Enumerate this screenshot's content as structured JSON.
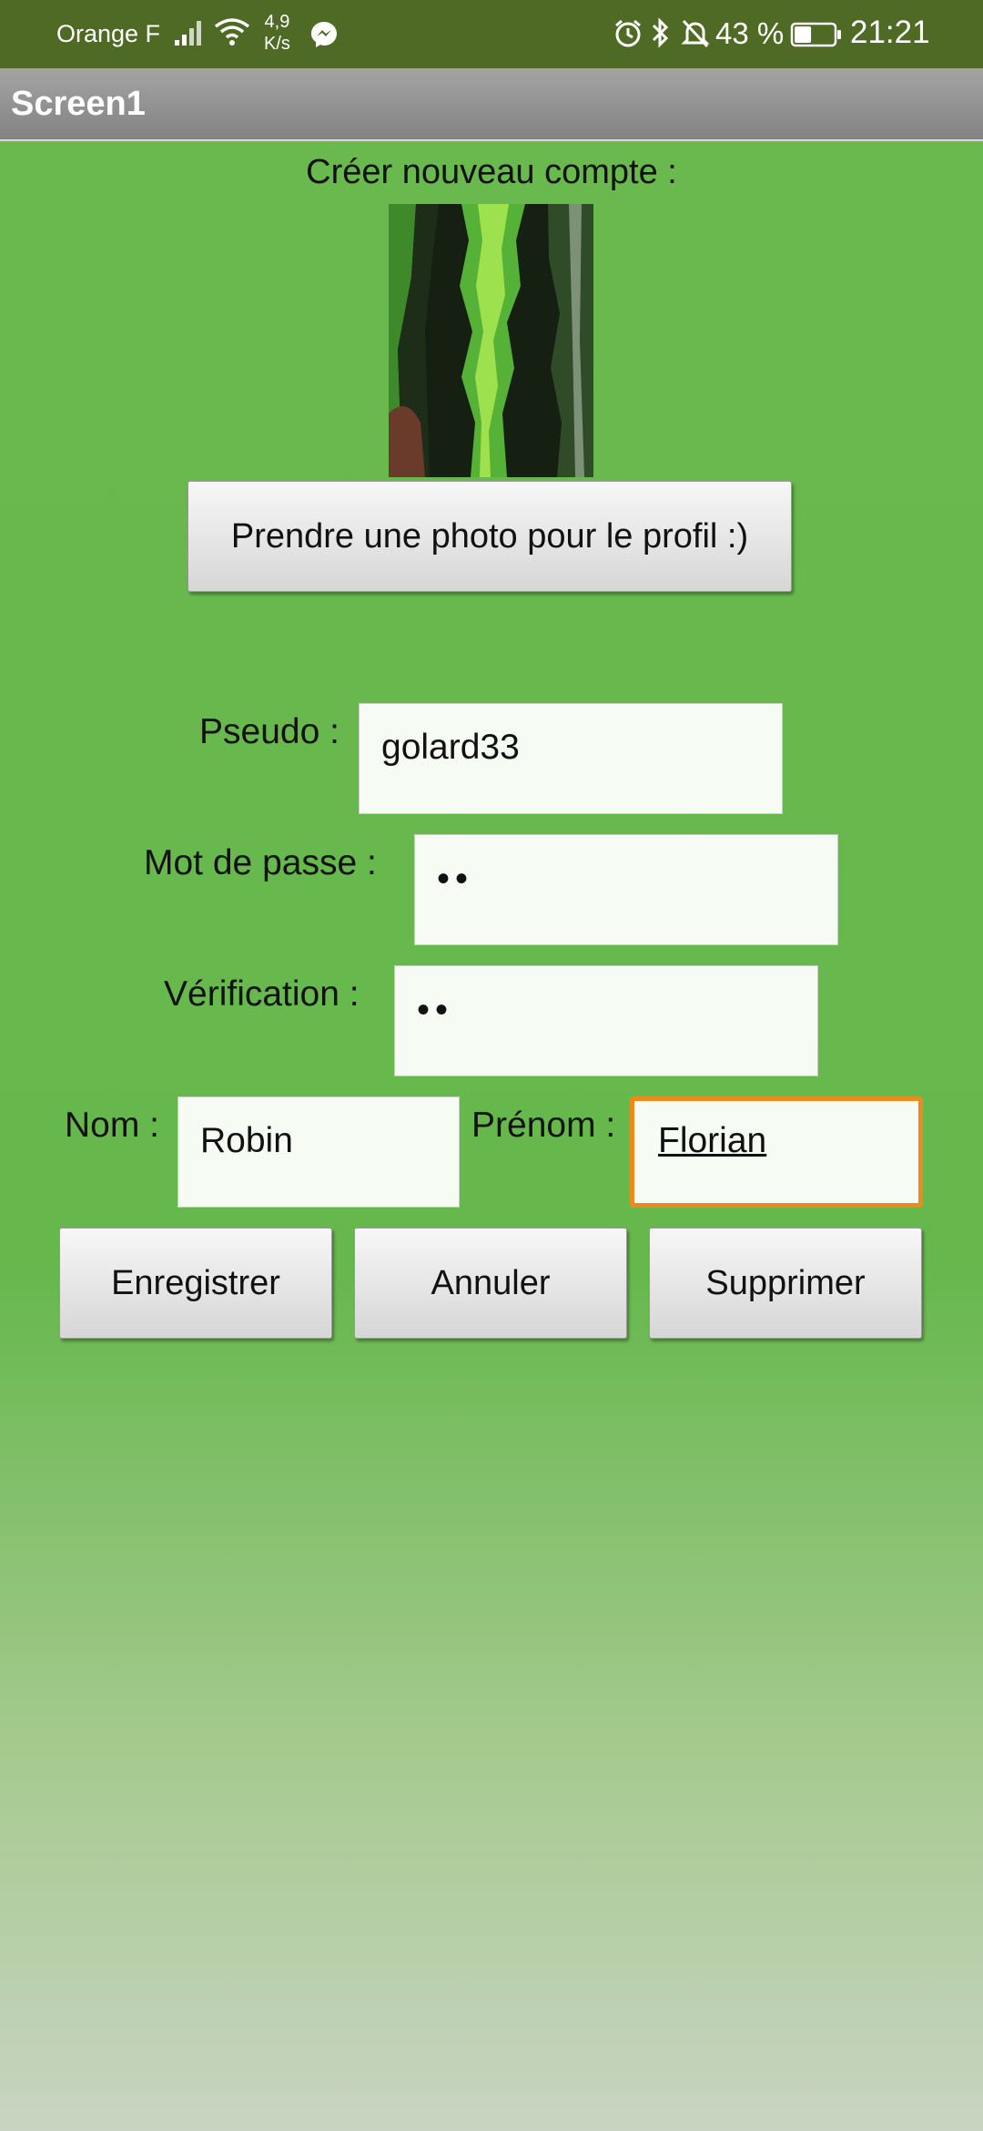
{
  "status_bar": {
    "carrier": "Orange F",
    "network_speed_value": "4,9",
    "network_speed_unit": "K/s",
    "battery_percent": "43 %",
    "battery_level": 0.43,
    "time": "21:21"
  },
  "app_bar": {
    "title": "Screen1"
  },
  "form": {
    "heading": "Créer nouveau compte :",
    "photo_button_label": "Prendre une photo pour le profil :)",
    "pseudo_label": "Pseudo :",
    "pseudo_value": "golard33",
    "password_label": "Mot de passe :",
    "password_value": "••",
    "verification_label": "Vérification :",
    "verification_value": "••",
    "nom_label": "Nom :",
    "nom_value": "Robin",
    "prenom_label": "Prénom :",
    "prenom_value": "Florian"
  },
  "actions": {
    "save_label": "Enregistrer",
    "cancel_label": "Annuler",
    "delete_label": "Supprimer"
  },
  "colors": {
    "status_bar": "#4e6a24",
    "background": "#6ab94e",
    "focus_border": "#ee8a1c"
  }
}
